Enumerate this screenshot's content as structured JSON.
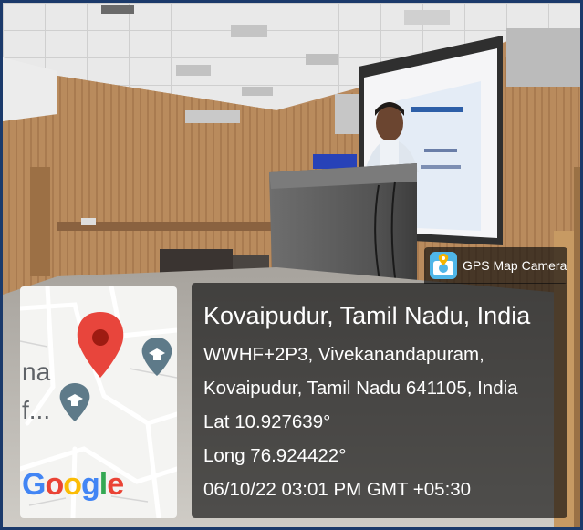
{
  "photo": {
    "description_scene": "Seminar hall, presenter at podium in front of projection screen"
  },
  "map": {
    "partial_label_1": "na",
    "partial_label_2": "f...",
    "logo_text": "Google",
    "pin_color": "#e8453c",
    "school_marker_color": "#5e7a89",
    "school_icon": "graduation-cap-icon"
  },
  "app": {
    "name": "GPS Map Camera",
    "icon": "gps-map-camera-icon"
  },
  "location": {
    "title": "Kovaipudur, Tamil Nadu, India",
    "address_line1": "WWHF+2P3, Vivekanandapuram,",
    "address_line2": "Kovaipudur, Tamil Nadu 641105, India",
    "latitude": "Lat 10.927639°",
    "longitude": "Long 76.924422°",
    "timestamp": "06/10/22 03:01 PM GMT +05:30"
  }
}
